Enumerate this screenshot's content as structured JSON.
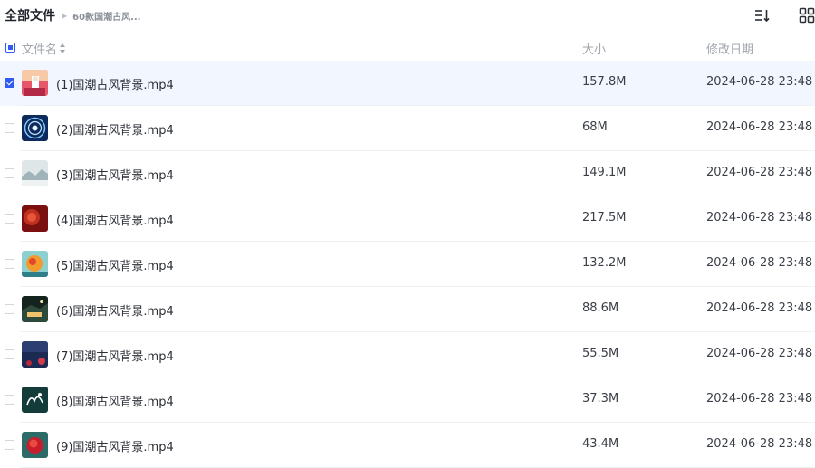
{
  "breadcrumb": {
    "root": "全部文件",
    "current": "60款国潮古风..."
  },
  "toolbar": {
    "sort_icon": "sort-list-icon",
    "grid_icon": "grid-view-icon"
  },
  "columns": {
    "name": "文件名",
    "size": "大小",
    "date": "修改日期"
  },
  "colors": {
    "accent": "#2f5cf5",
    "selected_row": "#f2f6fe"
  },
  "files": [
    {
      "name": "(1)国潮古风背景.mp4",
      "size": "157.8M",
      "date": "2024-06-28 23:48",
      "checked": true
    },
    {
      "name": "(2)国潮古风背景.mp4",
      "size": "68M",
      "date": "2024-06-28 23:48",
      "checked": false
    },
    {
      "name": "(3)国潮古风背景.mp4",
      "size": "149.1M",
      "date": "2024-06-28 23:48",
      "checked": false
    },
    {
      "name": "(4)国潮古风背景.mp4",
      "size": "217.5M",
      "date": "2024-06-28 23:48",
      "checked": false
    },
    {
      "name": "(5)国潮古风背景.mp4",
      "size": "132.2M",
      "date": "2024-06-28 23:48",
      "checked": false
    },
    {
      "name": "(6)国潮古风背景.mp4",
      "size": "88.6M",
      "date": "2024-06-28 23:48",
      "checked": false
    },
    {
      "name": "(7)国潮古风背景.mp4",
      "size": "55.5M",
      "date": "2024-06-28 23:48",
      "checked": false
    },
    {
      "name": "(8)国潮古风背景.mp4",
      "size": "37.3M",
      "date": "2024-06-28 23:48",
      "checked": false
    },
    {
      "name": "(9)国潮古风背景.mp4",
      "size": "43.4M",
      "date": "2024-06-28 23:48",
      "checked": false
    }
  ]
}
